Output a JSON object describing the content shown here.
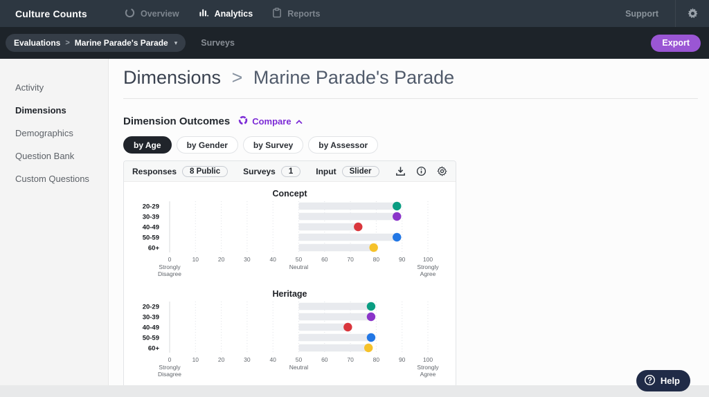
{
  "topbar": {
    "brand": "Culture Counts",
    "nav": [
      {
        "label": "Overview",
        "icon": "circle-arc"
      },
      {
        "label": "Analytics",
        "icon": "bar-chart",
        "active": true
      },
      {
        "label": "Reports",
        "icon": "clipboard"
      }
    ],
    "support_label": "Support"
  },
  "subbar": {
    "breadcrumb_section": "Evaluations",
    "breadcrumb_separator": ">",
    "breadcrumb_item": "Marine Parade's Parade",
    "surveys_label": "Surveys",
    "export_label": "Export"
  },
  "sidebar": {
    "items": [
      {
        "label": "Activity"
      },
      {
        "label": "Dimensions",
        "active": true
      },
      {
        "label": "Demographics"
      },
      {
        "label": "Question Bank"
      },
      {
        "label": "Custom Questions"
      }
    ]
  },
  "main": {
    "title_primary": "Dimensions",
    "title_separator": ">",
    "title_secondary": "Marine Parade's Parade",
    "section_title": "Dimension Outcomes",
    "compare_label": "Compare",
    "tabs": [
      {
        "label": "by Age",
        "active": true
      },
      {
        "label": "by Gender"
      },
      {
        "label": "by Survey"
      },
      {
        "label": "by Assessor"
      }
    ],
    "panel_header": {
      "responses_label": "Responses",
      "responses_value": "8 Public",
      "surveys_label": "Surveys",
      "surveys_value": "1",
      "input_label": "Input",
      "input_value": "Slider"
    }
  },
  "help": {
    "label": "Help"
  },
  "colors": {
    "accent_purple": "#7c2bd6",
    "export_purple": "#9a56d4",
    "help_navy": "#202b47",
    "topbar": "#2d3741",
    "subbar": "#1d2329",
    "bar_gray": "#e8eaee"
  },
  "chart_data": [
    {
      "type": "bar",
      "title": "Concept",
      "orientation": "horizontal",
      "categories": [
        "20-29",
        "30-39",
        "40-49",
        "50-59",
        "60+"
      ],
      "values": [
        88,
        88,
        73,
        88,
        79
      ],
      "point_colors": [
        "#0a9d82",
        "#8a34c9",
        "#d9363c",
        "#2277e5",
        "#f6c22a"
      ],
      "bar_color": "#e8eaee",
      "bar_start": 50,
      "xlim": [
        0,
        100
      ],
      "xticks": [
        0,
        10,
        20,
        30,
        40,
        50,
        60,
        70,
        80,
        90,
        100
      ],
      "captions": [
        {
          "at": 0,
          "lines": [
            "Strongly",
            "Disagree"
          ]
        },
        {
          "at": 50,
          "lines": [
            "Neutral"
          ]
        },
        {
          "at": 100,
          "lines": [
            "Strongly",
            "Agree"
          ]
        }
      ]
    },
    {
      "type": "bar",
      "title": "Heritage",
      "orientation": "horizontal",
      "categories": [
        "20-29",
        "30-39",
        "40-49",
        "50-59",
        "60+"
      ],
      "values": [
        78,
        78,
        69,
        78,
        77
      ],
      "point_colors": [
        "#0a9d82",
        "#8a34c9",
        "#d9363c",
        "#2277e5",
        "#f6c22a"
      ],
      "bar_color": "#e8eaee",
      "bar_start": 50,
      "xlim": [
        0,
        100
      ],
      "xticks": [
        0,
        10,
        20,
        30,
        40,
        50,
        60,
        70,
        80,
        90,
        100
      ],
      "captions": [
        {
          "at": 0,
          "lines": [
            "Strongly",
            "Disagree"
          ]
        },
        {
          "at": 50,
          "lines": [
            "Neutral"
          ]
        },
        {
          "at": 100,
          "lines": [
            "Strongly",
            "Agree"
          ]
        }
      ]
    }
  ]
}
